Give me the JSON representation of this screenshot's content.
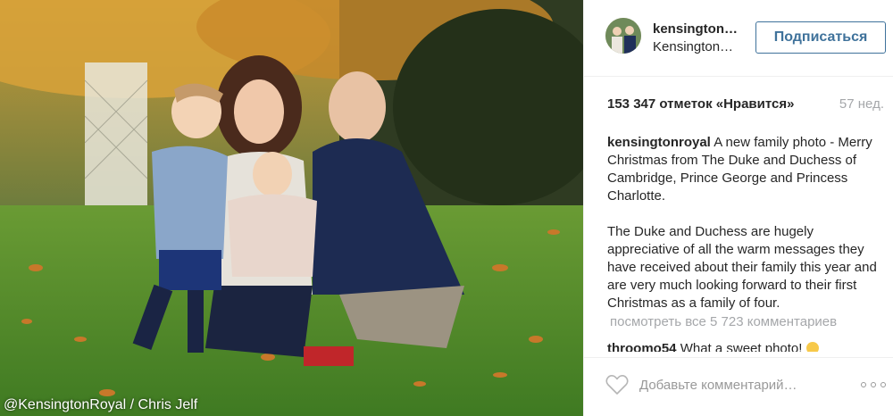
{
  "post": {
    "photo_alt": "Family photo in autumn garden",
    "photo_credit": "@KensingtonRoyal / Chris Jelf"
  },
  "header": {
    "username": "kensington…",
    "location": "Kensington…",
    "follow_label": "Подписаться"
  },
  "stats": {
    "likes": "153 347 отметок «Нравится»",
    "time_ago": "57 нед."
  },
  "caption": {
    "username": "kensingtonroyal",
    "paragraph1": "A new family photo - Merry Christmas from The Duke and Duchess of Cambridge, Prince George and Princess Charlotte.",
    "paragraph2": "The Duke and Duchess are hugely appreciative of all the warm messages they have received about their family this year and are very much looking forward to their first Christmas as a family of four."
  },
  "comments": {
    "view_all_label": "посмотреть все 5 723 комментариев",
    "items": [
      {
        "username": "throomo54",
        "text": "What a sweet photo!"
      }
    ]
  },
  "footer": {
    "comment_placeholder": "Добавьте комментарий…"
  },
  "icons": {
    "like": "heart-icon",
    "more": "more-options-icon",
    "emoji": "smile-emoji-icon"
  },
  "colors": {
    "follow_blue": "#3f729b",
    "muted_gray": "#a5a7aa",
    "text": "#262626"
  }
}
